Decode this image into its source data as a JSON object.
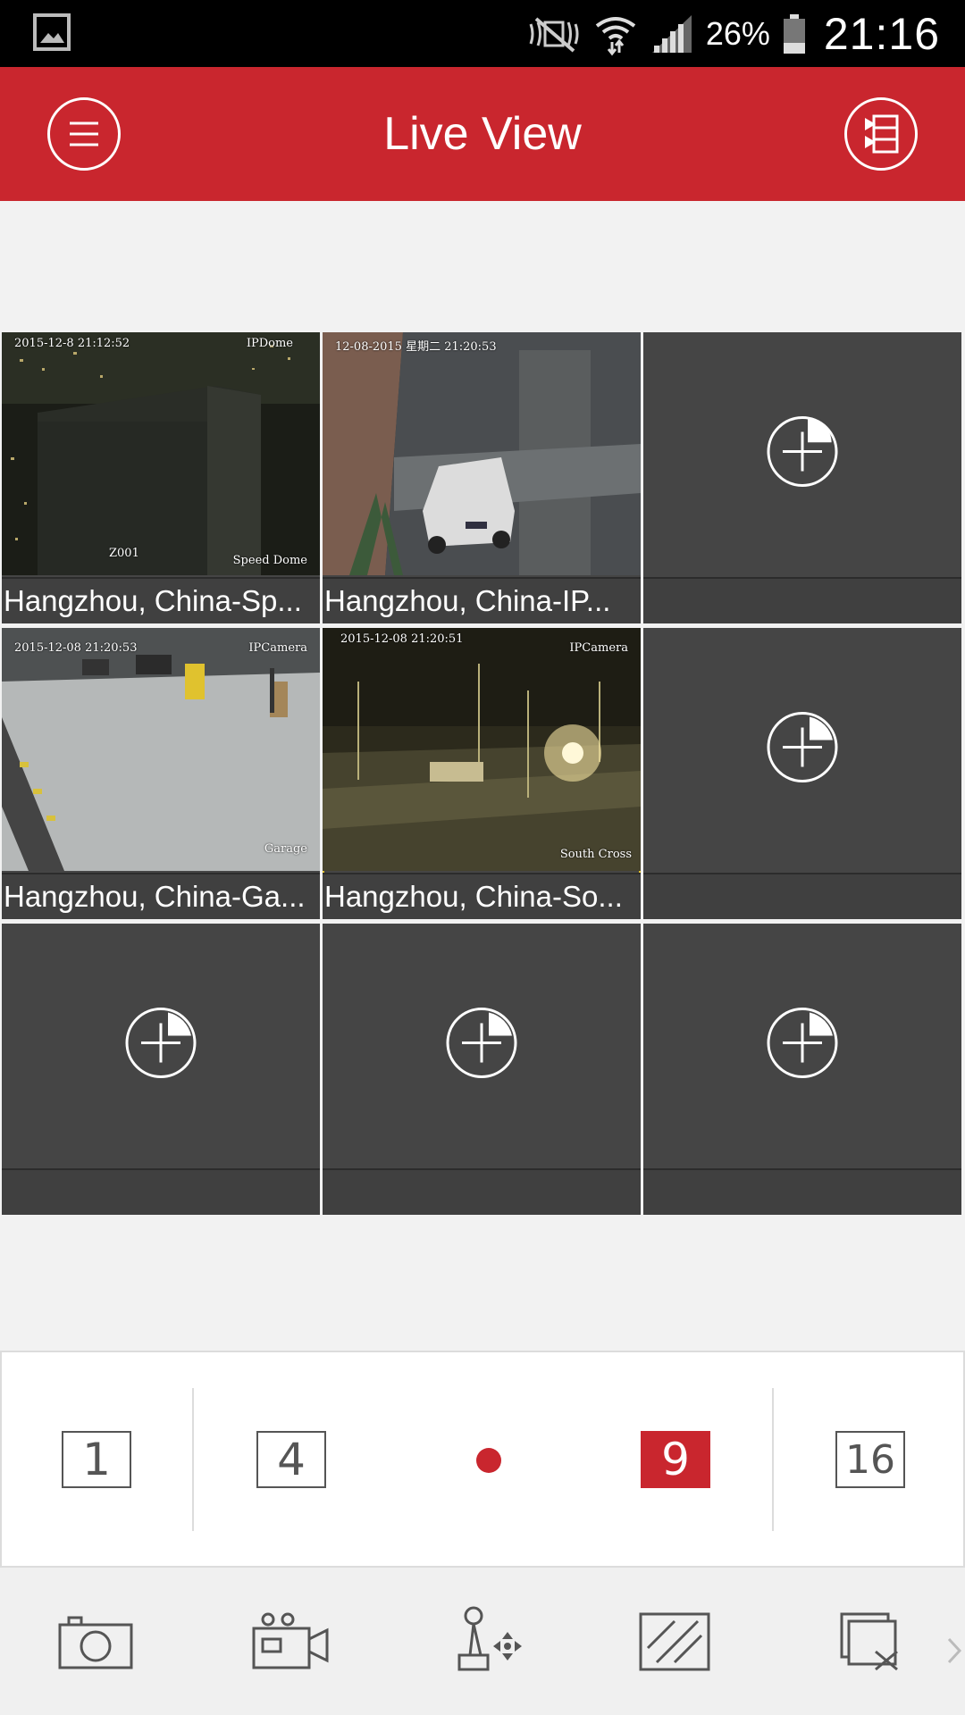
{
  "status_bar": {
    "battery_pct": "26%",
    "time": "21:16",
    "icons": [
      "gallery-icon",
      "mute-icon",
      "wifi-icon",
      "signal-icon",
      "battery-icon"
    ]
  },
  "app_bar": {
    "title": "Live View",
    "menu_icon": "menu-icon",
    "device_list_icon": "device-list-icon"
  },
  "grid": {
    "cells": [
      {
        "caption": "Hangzhou, China-Sp...",
        "osd_time": "2015-12-8 21:12:52",
        "osd_type": "IPDome",
        "osd_name": "Speed Dome",
        "osd_extra": "Z001"
      },
      {
        "caption": "Hangzhou, China-IP...",
        "osd_time": "12-08-2015 星期二 21:20:53"
      },
      {
        "caption": ""
      },
      {
        "caption": "Hangzhou, China-Ga...",
        "osd_time": "2015-12-08 21:20:53",
        "osd_type": "IPCamera",
        "osd_name": "Garage"
      },
      {
        "caption": "Hangzhou, China-So...",
        "osd_time": "2015-12-08 21:20:51",
        "osd_type": "IPCamera",
        "osd_name": "South Cross"
      },
      {
        "caption": ""
      },
      {
        "caption": ""
      },
      {
        "caption": ""
      },
      {
        "caption": ""
      }
    ],
    "selected_index": 4
  },
  "split_bar": {
    "options": [
      "1",
      "4",
      "9",
      "16"
    ],
    "active": "9"
  },
  "toolbar": {
    "tools": [
      "camera-icon",
      "record-icon",
      "ptz-icon",
      "image-quality-icon",
      "close-all-icon"
    ],
    "more_icon": "chevron-right-icon"
  },
  "colors": {
    "brand_red": "#c9262e",
    "tile_bg": "#454545",
    "selected_outline": "#e4c431"
  }
}
